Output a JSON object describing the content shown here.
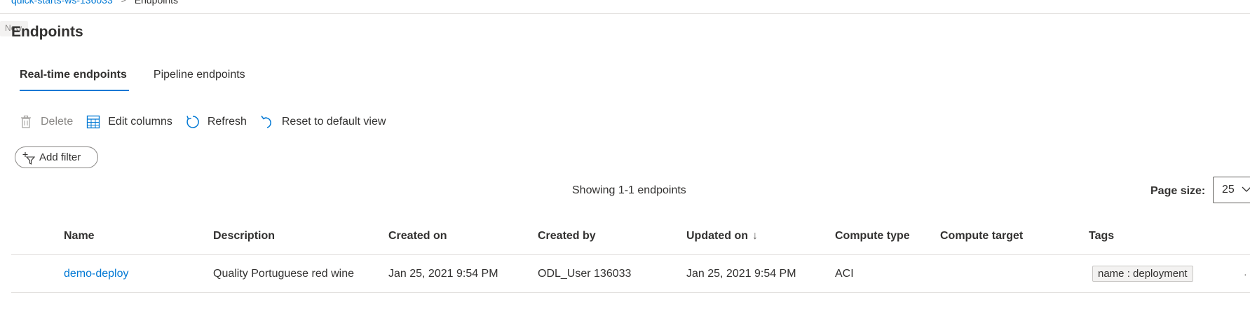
{
  "breadcrumb": {
    "workspace": "quick-starts-ws-136033",
    "separator": ">",
    "current": "Endpoints"
  },
  "new_badge": "New",
  "title": "Endpoints",
  "tabs": [
    {
      "label": "Real-time endpoints",
      "active": true
    },
    {
      "label": "Pipeline endpoints",
      "active": false
    }
  ],
  "toolbar": {
    "delete": "Delete",
    "edit_columns": "Edit columns",
    "refresh": "Refresh",
    "reset": "Reset to default view"
  },
  "filter": {
    "label": "Add filter"
  },
  "showing": "Showing 1-1 endpoints",
  "page_size": {
    "label": "Page size:",
    "value": "25"
  },
  "columns": {
    "name": "Name",
    "description": "Description",
    "created_on": "Created on",
    "created_by": "Created by",
    "updated_on": "Updated on",
    "compute_type": "Compute type",
    "compute_target": "Compute target",
    "tags": "Tags"
  },
  "rows": [
    {
      "name": "demo-deploy",
      "description": "Quality Portuguese red wine",
      "created_on": "Jan 25, 2021 9:54 PM",
      "created_by": "ODL_User 136033",
      "updated_on": "Jan 25, 2021 9:54 PM",
      "compute_type": "ACI",
      "compute_target": "",
      "tag": "name : deployment"
    }
  ],
  "colors": {
    "accent": "#0078d4",
    "text": "#323130",
    "muted": "#8a8886",
    "divider": "#e1dfdd"
  }
}
